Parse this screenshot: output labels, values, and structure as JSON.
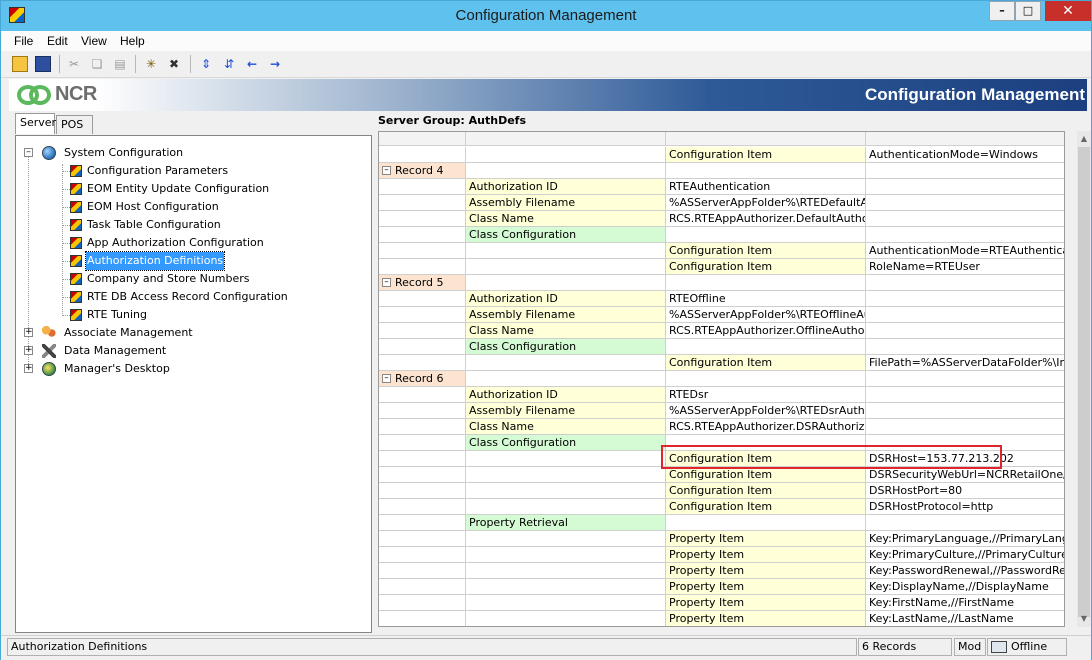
{
  "window": {
    "title": "Configuration Management"
  },
  "menu": [
    "File",
    "Edit",
    "View",
    "Help"
  ],
  "banner": {
    "logo_text": "NCR",
    "title": "Configuration Management"
  },
  "left_tabs": [
    {
      "label": "Server",
      "active": true
    },
    {
      "label": "POS",
      "active": false
    }
  ],
  "tree": {
    "root": {
      "label": "System Configuration",
      "icon": "globe-icon",
      "expanded": true
    },
    "children": [
      {
        "label": "Configuration Parameters"
      },
      {
        "label": "EOM Entity Update Configuration"
      },
      {
        "label": "EOM Host Configuration"
      },
      {
        "label": "Task Table Configuration"
      },
      {
        "label": "App Authorization Configuration"
      },
      {
        "label": "Authorization Definitions",
        "selected": true
      },
      {
        "label": "Company and Store Numbers"
      },
      {
        "label": "RTE DB Access Record Configuration"
      },
      {
        "label": "RTE Tuning"
      }
    ],
    "others": [
      {
        "label": "Associate Management",
        "icon": "people-icon"
      },
      {
        "label": "Data Management",
        "icon": "tools-icon"
      },
      {
        "label": "Manager's Desktop",
        "icon": "desktop-icon"
      }
    ]
  },
  "grid": {
    "title": "Server Group: AuthDefs",
    "rows": [
      {
        "c0": "",
        "c1": "",
        "c2": "Configuration Item",
        "c3": "AuthenticationMode=Windows",
        "t": "cfg"
      },
      {
        "c0": "Record 4",
        "c1": "",
        "c2": "",
        "c3": "",
        "t": "record"
      },
      {
        "c0": "",
        "c1": "Authorization ID",
        "c2": "RTEAuthentication",
        "c3": "",
        "t": "field"
      },
      {
        "c0": "",
        "c1": "Assembly Filename",
        "c2": "%ASServerAppFolder%\\RTEDefaultAuthorizer.dll",
        "c3": "",
        "t": "field"
      },
      {
        "c0": "",
        "c1": "Class Name",
        "c2": "RCS.RTEAppAuthorizer.DefaultAuthorizer",
        "c3": "",
        "t": "field"
      },
      {
        "c0": "",
        "c1": "Class Configuration",
        "c2": "",
        "c3": "",
        "t": "green"
      },
      {
        "c0": "",
        "c1": "",
        "c2": "Configuration Item",
        "c3": "AuthenticationMode=RTEAuthentication",
        "t": "cfg"
      },
      {
        "c0": "",
        "c1": "",
        "c2": "Configuration Item",
        "c3": "RoleName=RTEUser",
        "t": "cfg"
      },
      {
        "c0": "Record 5",
        "c1": "",
        "c2": "",
        "c3": "",
        "t": "record"
      },
      {
        "c0": "",
        "c1": "Authorization ID",
        "c2": "RTEOffline",
        "c3": "",
        "t": "field"
      },
      {
        "c0": "",
        "c1": "Assembly Filename",
        "c2": "%ASServerAppFolder%\\RTEOfflineAuthorizer.dll",
        "c3": "",
        "t": "field"
      },
      {
        "c0": "",
        "c1": "Class Name",
        "c2": "RCS.RTEAppAuthorizer.OfflineAuthorizer",
        "c3": "",
        "t": "field"
      },
      {
        "c0": "",
        "c1": "Class Configuration",
        "c2": "",
        "c3": "",
        "t": "green"
      },
      {
        "c0": "",
        "c1": "",
        "c2": "Configuration Item",
        "c3": "FilePath=%ASServerDataFolder%\\Install\\",
        "t": "cfg"
      },
      {
        "c0": "Record 6",
        "c1": "",
        "c2": "",
        "c3": "",
        "t": "record"
      },
      {
        "c0": "",
        "c1": "Authorization ID",
        "c2": "RTEDsr",
        "c3": "",
        "t": "field"
      },
      {
        "c0": "",
        "c1": "Assembly Filename",
        "c2": "%ASServerAppFolder%\\RTEDsrAuthorizer.dll",
        "c3": "",
        "t": "field"
      },
      {
        "c0": "",
        "c1": "Class Name",
        "c2": "RCS.RTEAppAuthorizer.DSRAuthorizer",
        "c3": "",
        "t": "field"
      },
      {
        "c0": "",
        "c1": "Class Configuration",
        "c2": "",
        "c3": "",
        "t": "green"
      },
      {
        "c0": "",
        "c1": "",
        "c2": "Configuration Item",
        "c3": "DSRHost=153.77.213.202",
        "t": "cfg"
      },
      {
        "c0": "",
        "c1": "",
        "c2": "Configuration Item",
        "c3": "DSRSecurityWebUrl=NCRRetailOne/api/",
        "t": "cfg"
      },
      {
        "c0": "",
        "c1": "",
        "c2": "Configuration Item",
        "c3": "DSRHostPort=80",
        "t": "cfg"
      },
      {
        "c0": "",
        "c1": "",
        "c2": "Configuration Item",
        "c3": "DSRHostProtocol=http",
        "t": "cfg"
      },
      {
        "c0": "",
        "c1": "Property Retrieval",
        "c2": "",
        "c3": "",
        "t": "green"
      },
      {
        "c0": "",
        "c1": "",
        "c2": "Property Item",
        "c3": "Key:PrimaryLanguage,//PrimaryLanguage",
        "t": "cfg"
      },
      {
        "c0": "",
        "c1": "",
        "c2": "Property Item",
        "c3": "Key:PrimaryCulture,//PrimaryCulture",
        "t": "cfg"
      },
      {
        "c0": "",
        "c1": "",
        "c2": "Property Item",
        "c3": "Key:PasswordRenewal,//PasswordRenewal",
        "t": "cfg"
      },
      {
        "c0": "",
        "c1": "",
        "c2": "Property Item",
        "c3": "Key:DisplayName,//DisplayName",
        "t": "cfg"
      },
      {
        "c0": "",
        "c1": "",
        "c2": "Property Item",
        "c3": "Key:FirstName,//FirstName",
        "t": "cfg"
      },
      {
        "c0": "",
        "c1": "",
        "c2": "Property Item",
        "c3": "Key:LastName,//LastName",
        "t": "cfg"
      }
    ]
  },
  "status": {
    "left": "Authorization Definitions",
    "records": "6 Records",
    "mode": "Mod",
    "connection": "Offline"
  },
  "colors": {
    "titlebar": "#5fc1ee",
    "record_bg": "#fce4d0",
    "field_bg": "#ffffd8",
    "green_bg": "#d5fbd5",
    "highlight_border": "#e0262c",
    "selection": "#3399ff"
  }
}
